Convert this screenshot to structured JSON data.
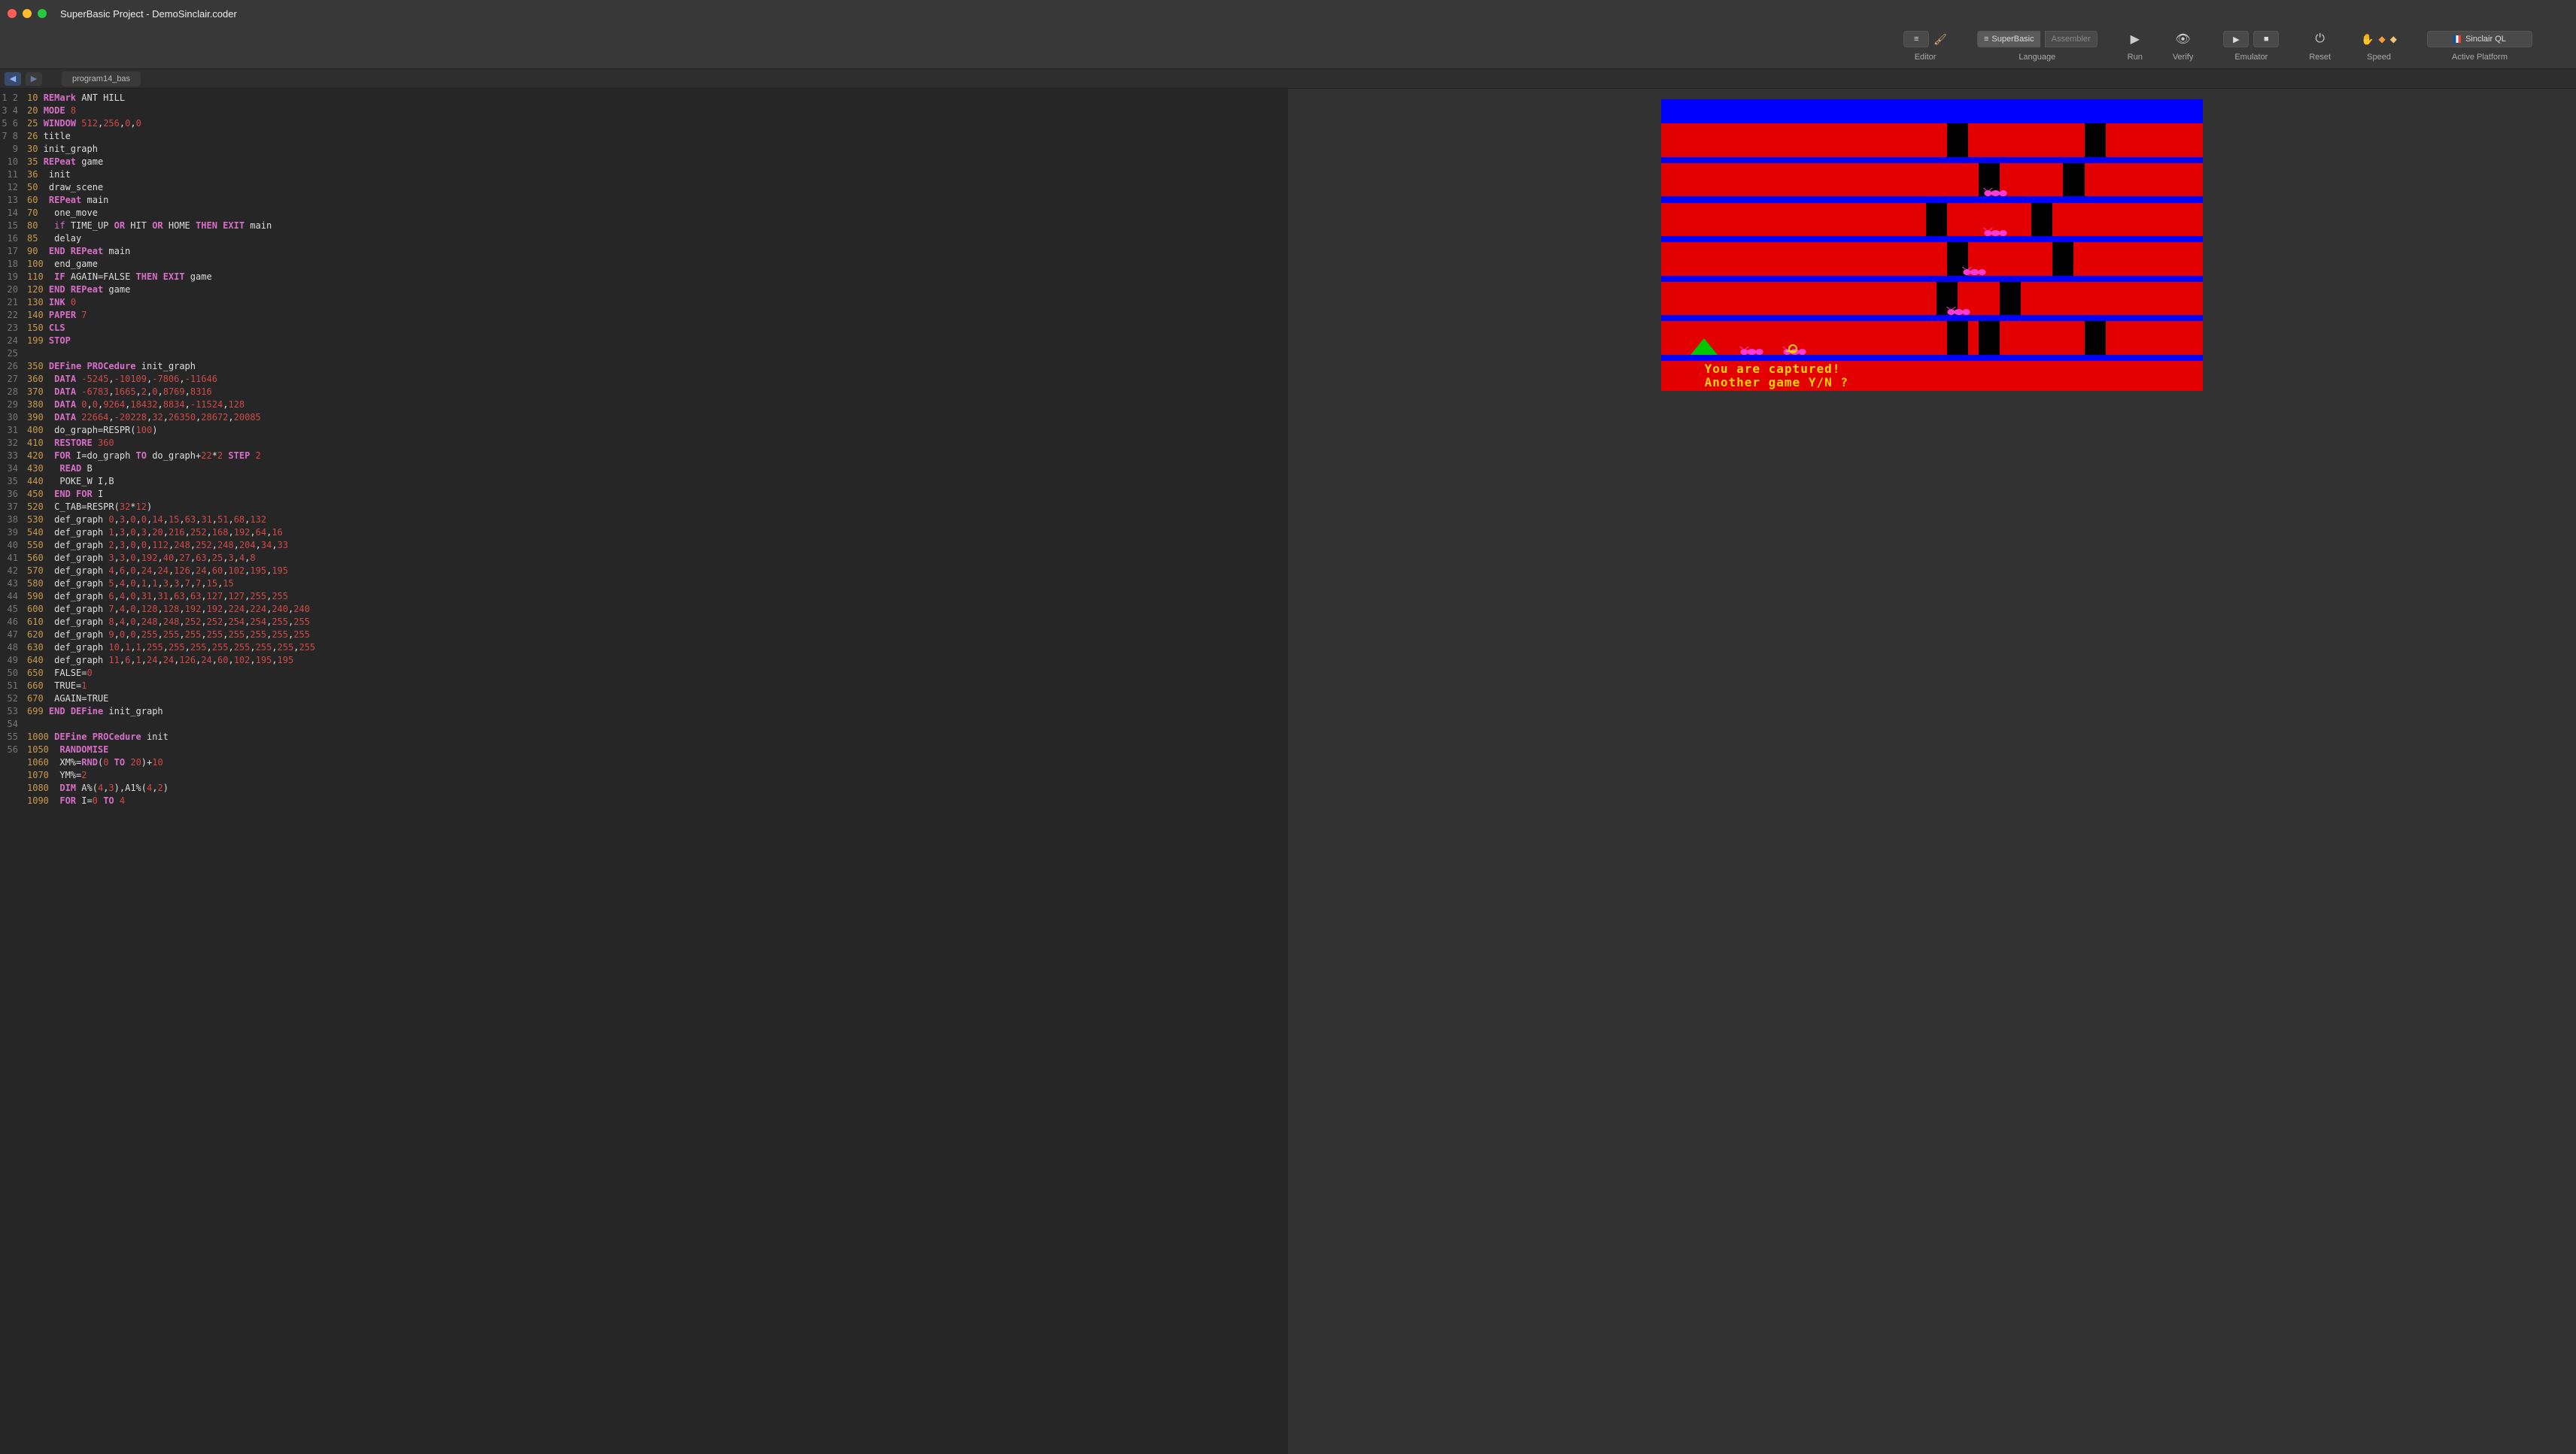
{
  "window": {
    "title": "SuperBasic Project - DemoSinclair.coder"
  },
  "toolbar": {
    "editor_label": "Editor",
    "language_label": "Language",
    "language_seg": {
      "superbasic": "SuperBasic",
      "assembler": "Assembler"
    },
    "run_label": "Run",
    "verify_label": "Verify",
    "emulator_label": "Emulator",
    "reset_label": "Reset",
    "speed_label": "Speed",
    "platform_label": "Active Platform",
    "platform_value": "Sinclair QL"
  },
  "tabs": {
    "file1": "program14_bas"
  },
  "code_lines": [
    {
      "g": "1",
      "raw": "<span class='ln'>10</span> <span class='kw'>REMark</span> ANT HILL"
    },
    {
      "g": "2",
      "raw": "<span class='ln'>20</span> <span class='kw'>MODE</span> <span class='nm'>8</span>"
    },
    {
      "g": "3",
      "raw": "<span class='ln'>25</span> <span class='kw'>WINDOW</span> <span class='nm'>512</span>,<span class='nm'>256</span>,<span class='nm'>0</span>,<span class='nm'>0</span>"
    },
    {
      "g": "4",
      "raw": "<span class='ln'>26</span> title"
    },
    {
      "g": "5",
      "raw": "<span class='ln'>30</span> init_graph"
    },
    {
      "g": "6",
      "raw": "<span class='ln'>35</span> <span class='kw'>REPeat</span> game"
    },
    {
      "g": "7",
      "raw": "<span class='ln'>36</span>  init"
    },
    {
      "g": "8",
      "raw": "<span class='ln'>50</span>  draw_scene"
    },
    {
      "g": "9",
      "raw": "<span class='ln'>60</span>  <span class='kw'>REPeat</span> main"
    },
    {
      "g": "10",
      "raw": "<span class='ln'>70</span>   one_move"
    },
    {
      "g": "11",
      "raw": "<span class='ln'>80</span>   <span class='kw2'>if</span> TIME_UP <span class='kw'>OR</span> HIT <span class='kw'>OR</span> HOME <span class='kw'>THEN</span> <span class='kw'>EXIT</span> main"
    },
    {
      "g": "12",
      "raw": "<span class='ln'>85</span>   delay"
    },
    {
      "g": "13",
      "raw": "<span class='ln'>90</span>  <span class='kw'>END REPeat</span> main"
    },
    {
      "g": "14",
      "raw": "<span class='ln'>100</span>  end_game"
    },
    {
      "g": "15",
      "raw": "<span class='ln'>110</span>  <span class='kw'>IF</span> AGAIN=FALSE <span class='kw'>THEN</span> <span class='kw'>EXIT</span> game"
    },
    {
      "g": "16",
      "raw": "<span class='ln'>120</span> <span class='kw'>END REPeat</span> game"
    },
    {
      "g": "17",
      "raw": "<span class='ln'>130</span> <span class='kw'>INK</span> <span class='nm'>0</span>"
    },
    {
      "g": "18",
      "raw": "<span class='ln'>140</span> <span class='kw'>PAPER</span> <span class='nm'>7</span>"
    },
    {
      "g": "19",
      "raw": "<span class='ln'>150</span> <span class='kw'>CLS</span>"
    },
    {
      "g": "20",
      "raw": "<span class='ln'>199</span> <span class='kw'>STOP</span>"
    },
    {
      "g": "21",
      "raw": ""
    },
    {
      "g": "22",
      "raw": "<span class='ln'>350</span> <span class='kw'>DEFine PROCedure</span> init_graph"
    },
    {
      "g": "23",
      "raw": "<span class='ln'>360</span>  <span class='kw'>DATA</span> <span class='nm'>-5245</span>,<span class='nm'>-10109</span>,<span class='nm'>-7806</span>,<span class='nm'>-11646</span>"
    },
    {
      "g": "24",
      "raw": "<span class='ln'>370</span>  <span class='kw'>DATA</span> <span class='nm'>-6783</span>,<span class='nm'>1665</span>,<span class='nm'>2</span>,<span class='nm'>0</span>,<span class='nm'>8769</span>,<span class='nm'>8316</span>"
    },
    {
      "g": "25",
      "raw": "<span class='ln'>380</span>  <span class='kw'>DATA</span> <span class='nm'>0</span>,<span class='nm'>0</span>,<span class='nm'>9264</span>,<span class='nm'>18432</span>,<span class='nm'>8834</span>,<span class='nm'>-11524</span>,<span class='nm'>128</span>"
    },
    {
      "g": "26",
      "raw": "<span class='ln'>390</span>  <span class='kw'>DATA</span> <span class='nm'>22664</span>,<span class='nm'>-20228</span>,<span class='nm'>32</span>,<span class='nm'>26350</span>,<span class='nm'>28672</span>,<span class='nm'>20085</span>"
    },
    {
      "g": "27",
      "raw": "<span class='ln'>400</span>  do_graph=RESPR(<span class='nm'>100</span>)"
    },
    {
      "g": "28",
      "raw": "<span class='ln'>410</span>  <span class='kw'>RESTORE</span> <span class='nm'>360</span>"
    },
    {
      "g": "29",
      "raw": "<span class='ln'>420</span>  <span class='kw'>FOR</span> I=do_graph <span class='kw'>TO</span> do_graph+<span class='nm'>22</span>*<span class='nm'>2</span> <span class='kw'>STEP</span> <span class='nm'>2</span>"
    },
    {
      "g": "30",
      "raw": "<span class='ln'>430</span>   <span class='kw'>READ</span> B"
    },
    {
      "g": "31",
      "raw": "<span class='ln'>440</span>   POKE_W I,B"
    },
    {
      "g": "32",
      "raw": "<span class='ln'>450</span>  <span class='kw'>END FOR</span> I"
    },
    {
      "g": "33",
      "raw": "<span class='ln'>520</span>  C_TAB=RESPR(<span class='nm'>32</span>*<span class='nm'>12</span>)"
    },
    {
      "g": "34",
      "raw": "<span class='ln'>530</span>  def_graph <span class='nm'>0</span>,<span class='nm'>3</span>,<span class='nm'>0</span>,<span class='nm'>0</span>,<span class='nm'>14</span>,<span class='nm'>15</span>,<span class='nm'>63</span>,<span class='nm'>31</span>,<span class='nm'>51</span>,<span class='nm'>68</span>,<span class='nm'>132</span>"
    },
    {
      "g": "35",
      "raw": "<span class='ln'>540</span>  def_graph <span class='nm'>1</span>,<span class='nm'>3</span>,<span class='nm'>0</span>,<span class='nm'>3</span>,<span class='nm'>20</span>,<span class='nm'>216</span>,<span class='nm'>252</span>,<span class='nm'>168</span>,<span class='nm'>192</span>,<span class='nm'>64</span>,<span class='nm'>16</span>"
    },
    {
      "g": "36",
      "raw": "<span class='ln'>550</span>  def_graph <span class='nm'>2</span>,<span class='nm'>3</span>,<span class='nm'>0</span>,<span class='nm'>0</span>,<span class='nm'>112</span>,<span class='nm'>248</span>,<span class='nm'>252</span>,<span class='nm'>248</span>,<span class='nm'>204</span>,<span class='nm'>34</span>,<span class='nm'>33</span>"
    },
    {
      "g": "37",
      "raw": "<span class='ln'>560</span>  def_graph <span class='nm'>3</span>,<span class='nm'>3</span>,<span class='nm'>0</span>,<span class='nm'>192</span>,<span class='nm'>40</span>,<span class='nm'>27</span>,<span class='nm'>63</span>,<span class='nm'>25</span>,<span class='nm'>3</span>,<span class='nm'>4</span>,<span class='nm'>8</span>"
    },
    {
      "g": "38",
      "raw": "<span class='ln'>570</span>  def_graph <span class='nm'>4</span>,<span class='nm'>6</span>,<span class='nm'>0</span>,<span class='nm'>24</span>,<span class='nm'>24</span>,<span class='nm'>126</span>,<span class='nm'>24</span>,<span class='nm'>60</span>,<span class='nm'>102</span>,<span class='nm'>195</span>,<span class='nm'>195</span>"
    },
    {
      "g": "39",
      "raw": "<span class='ln'>580</span>  def_graph <span class='nm'>5</span>,<span class='nm'>4</span>,<span class='nm'>0</span>,<span class='nm'>1</span>,<span class='nm'>1</span>,<span class='nm'>3</span>,<span class='nm'>3</span>,<span class='nm'>7</span>,<span class='nm'>7</span>,<span class='nm'>15</span>,<span class='nm'>15</span>"
    },
    {
      "g": "40",
      "raw": "<span class='ln'>590</span>  def_graph <span class='nm'>6</span>,<span class='nm'>4</span>,<span class='nm'>0</span>,<span class='nm'>31</span>,<span class='nm'>31</span>,<span class='nm'>63</span>,<span class='nm'>63</span>,<span class='nm'>127</span>,<span class='nm'>127</span>,<span class='nm'>255</span>,<span class='nm'>255</span>"
    },
    {
      "g": "41",
      "raw": "<span class='ln'>600</span>  def_graph <span class='nm'>7</span>,<span class='nm'>4</span>,<span class='nm'>0</span>,<span class='nm'>128</span>,<span class='nm'>128</span>,<span class='nm'>192</span>,<span class='nm'>192</span>,<span class='nm'>224</span>,<span class='nm'>224</span>,<span class='nm'>240</span>,<span class='nm'>240</span>"
    },
    {
      "g": "42",
      "raw": "<span class='ln'>610</span>  def_graph <span class='nm'>8</span>,<span class='nm'>4</span>,<span class='nm'>0</span>,<span class='nm'>248</span>,<span class='nm'>248</span>,<span class='nm'>252</span>,<span class='nm'>252</span>,<span class='nm'>254</span>,<span class='nm'>254</span>,<span class='nm'>255</span>,<span class='nm'>255</span>"
    },
    {
      "g": "43",
      "raw": "<span class='ln'>620</span>  def_graph <span class='nm'>9</span>,<span class='nm'>0</span>,<span class='nm'>0</span>,<span class='nm'>255</span>,<span class='nm'>255</span>,<span class='nm'>255</span>,<span class='nm'>255</span>,<span class='nm'>255</span>,<span class='nm'>255</span>,<span class='nm'>255</span>,<span class='nm'>255</span>"
    },
    {
      "g": "44",
      "raw": "<span class='ln'>630</span>  def_graph <span class='nm'>10</span>,<span class='nm'>1</span>,<span class='nm'>1</span>,<span class='nm'>255</span>,<span class='nm'>255</span>,<span class='nm'>255</span>,<span class='nm'>255</span>,<span class='nm'>255</span>,<span class='nm'>255</span>,<span class='nm'>255</span>,<span class='nm'>255</span>"
    },
    {
      "g": "45",
      "raw": "<span class='ln'>640</span>  def_graph <span class='nm'>11</span>,<span class='nm'>6</span>,<span class='nm'>1</span>,<span class='nm'>24</span>,<span class='nm'>24</span>,<span class='nm'>126</span>,<span class='nm'>24</span>,<span class='nm'>60</span>,<span class='nm'>102</span>,<span class='nm'>195</span>,<span class='nm'>195</span>"
    },
    {
      "g": "46",
      "raw": "<span class='ln'>650</span>  FALSE=<span class='nm'>0</span>"
    },
    {
      "g": "47",
      "raw": "<span class='ln'>660</span>  TRUE=<span class='nm'>1</span>"
    },
    {
      "g": "48",
      "raw": "<span class='ln'>670</span>  AGAIN=TRUE"
    },
    {
      "g": "49",
      "raw": "<span class='ln'>699</span> <span class='kw'>END DEFine</span> init_graph"
    },
    {
      "g": "50",
      "raw": ""
    },
    {
      "g": "51",
      "raw": "<span class='ln'>1000</span> <span class='kw'>DEFine PROCedure</span> init"
    },
    {
      "g": "52",
      "raw": "<span class='ln'>1050</span>  <span class='kw'>RANDOMISE</span>"
    },
    {
      "g": "53",
      "raw": "<span class='ln'>1060</span>  XM%=<span class='kw'>RND</span>(<span class='nm'>0</span> <span class='kw'>TO</span> <span class='nm'>20</span>)+<span class='nm'>10</span>"
    },
    {
      "g": "54",
      "raw": "<span class='ln'>1070</span>  YM%=<span class='nm'>2</span>"
    },
    {
      "g": "55",
      "raw": "<span class='ln'>1080</span>  <span class='kw'>DIM</span> A%(<span class='nm'>4</span>,<span class='nm'>3</span>),A1%(<span class='nm'>4</span>,<span class='nm'>2</span>)"
    },
    {
      "g": "56",
      "raw": "<span class='ln'>1090</span>  <span class='kw'>FOR</span> I=<span class='nm'>0</span> <span class='kw'>TO</span> <span class='nm'>4</span>"
    }
  ],
  "game": {
    "msg1": "You are captured!",
    "msg2": "Another game Y/N ?"
  }
}
